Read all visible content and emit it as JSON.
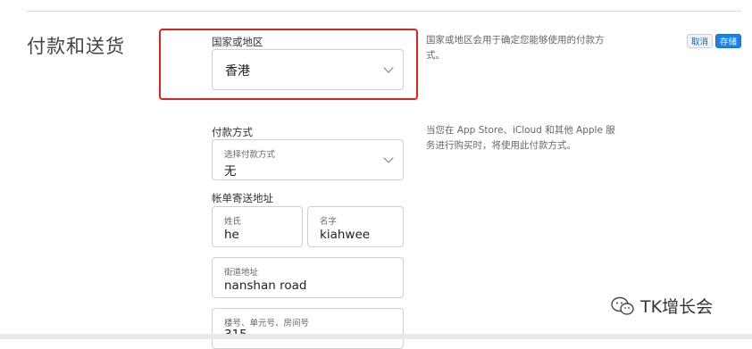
{
  "section": {
    "title": "付款和送货"
  },
  "country": {
    "label": "国家或地区",
    "value": "香港",
    "help": "国家或地区会用于确定您能够使用的付款方式。"
  },
  "actions": {
    "cancel": "取消",
    "save": "存储"
  },
  "payment": {
    "label": "付款方式",
    "select_caption": "选择付款方式",
    "select_value": "无",
    "help": "当您在 App Store、iCloud 和其他 Apple 服务进行购买时，将使用此付款方式。"
  },
  "billing": {
    "label": "帐单寄送地址",
    "last_name": {
      "caption": "姓氏",
      "value": "he"
    },
    "first_name": {
      "caption": "名字",
      "value": "kiahwee"
    },
    "street": {
      "caption": "街道地址",
      "value": "nanshan road"
    },
    "unit": {
      "caption": "楼号、单元号、房间号",
      "value": "315"
    }
  },
  "watermark": {
    "text": "TK增长会"
  },
  "colors": {
    "highlight": "#e0231e",
    "accent": "#1a82e2"
  }
}
